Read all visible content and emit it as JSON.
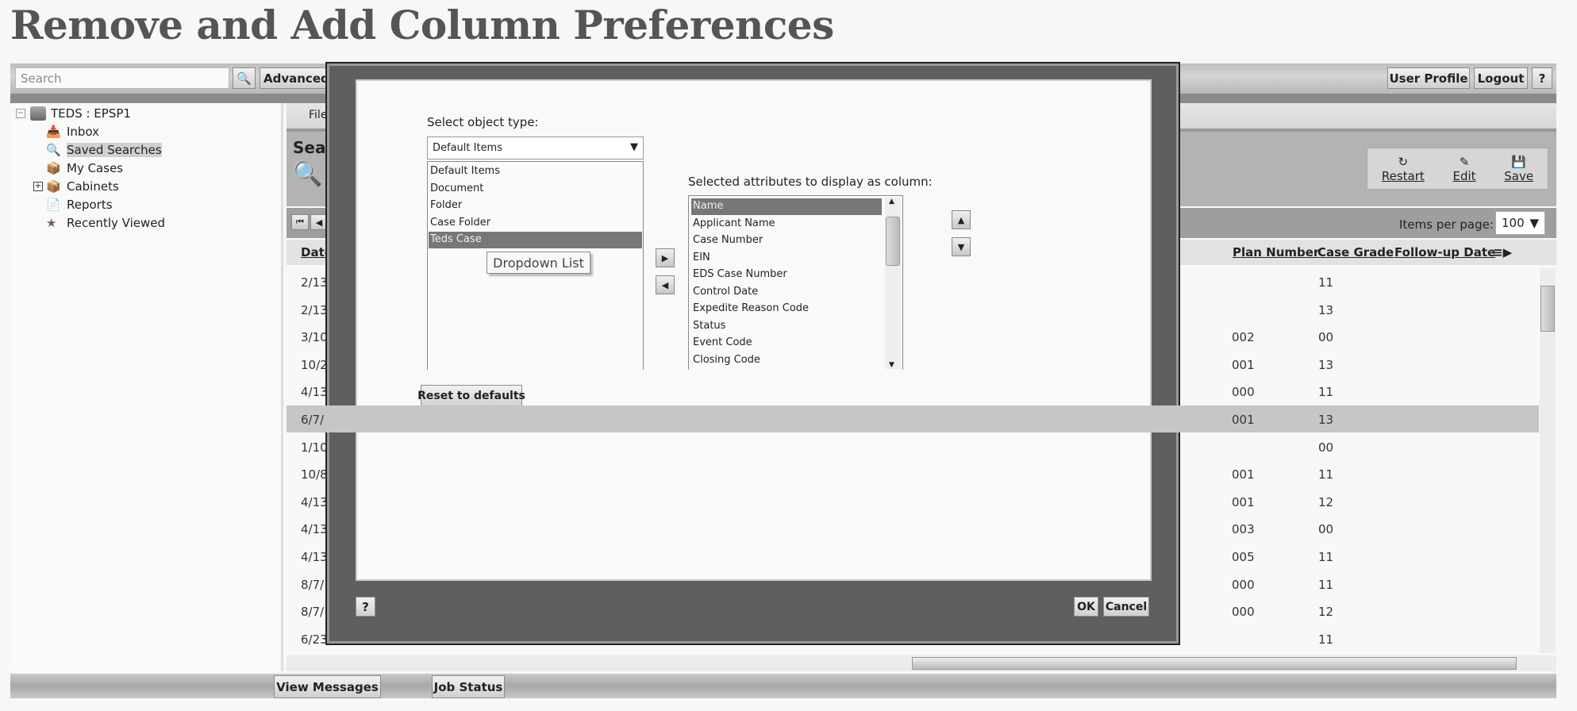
{
  "title": "Remove and Add Column Preferences",
  "topbar": {
    "search_placeholder": "Search",
    "search_icon": "magnifier",
    "advanced": "Advanced",
    "user_profile": "User Profile",
    "logout": "Logout",
    "help": "?"
  },
  "sidebar": {
    "root": "TEDS : EPSP1",
    "items": [
      {
        "label": "Inbox",
        "icon": "inbox"
      },
      {
        "label": "Saved Searches",
        "icon": "magnifier",
        "selected": true
      },
      {
        "label": "My Cases",
        "icon": "cases"
      },
      {
        "label": "Cabinets",
        "icon": "cabinets",
        "expandable": true
      },
      {
        "label": "Reports",
        "icon": "report"
      },
      {
        "label": "Recently Viewed",
        "icon": "star"
      }
    ]
  },
  "main": {
    "tab": "File",
    "panel_title": "Searc",
    "actions": [
      {
        "label": "Restart",
        "icon": "restart"
      },
      {
        "label": "Edit",
        "icon": "edit"
      },
      {
        "label": "Save",
        "icon": "floppy"
      }
    ],
    "items_per_page_label": "Items per page:",
    "items_per_page": "100",
    "columns": {
      "date": "Date",
      "plan_number": "Plan Number",
      "case_grade": "Case Grade",
      "followup_date": "Follow-up Date"
    },
    "rows": [
      {
        "date": "2/13",
        "plan": "",
        "grade": "11"
      },
      {
        "date": "2/13",
        "plan": "",
        "grade": "13"
      },
      {
        "date": "3/10",
        "plan": "002",
        "grade": "00"
      },
      {
        "date": "10/2",
        "plan": "001",
        "grade": "13"
      },
      {
        "date": "4/13",
        "plan": "000",
        "grade": "11"
      },
      {
        "date": "6/7/",
        "plan": "001",
        "grade": "13",
        "selected": true
      },
      {
        "date": "1/10",
        "plan": "",
        "grade": "00"
      },
      {
        "date": "10/8",
        "plan": "001",
        "grade": "11"
      },
      {
        "date": "4/13",
        "plan": "001",
        "grade": "12"
      },
      {
        "date": "4/13",
        "plan": "003",
        "grade": "00"
      },
      {
        "date": "4/13",
        "plan": "005",
        "grade": "11"
      },
      {
        "date": "8/7/",
        "plan": "000",
        "grade": "11"
      },
      {
        "date": "8/7/",
        "plan": "000",
        "grade": "12"
      },
      {
        "date": "6/23",
        "plan": "",
        "grade": "11"
      }
    ]
  },
  "bottom": {
    "view_messages": "View Messages",
    "job_status": "Job Status"
  },
  "dialog": {
    "object_type_label": "Select object type:",
    "object_type_value": "Default Items",
    "object_types": [
      "Default Items",
      "Document",
      "Folder",
      "Case Folder",
      "Teds Case"
    ],
    "highlighted_type": "Teds Case",
    "tooltip": "Dropdown List",
    "attributes_label": "Selected attributes to display as column:",
    "attributes": [
      "Name",
      "Applicant Name",
      "Case Number",
      "EIN",
      "EDS Case Number",
      "Control Date",
      "Expedite Reason Code",
      "Status",
      "Event Code",
      "Closing Code"
    ],
    "selected_attribute": "Name",
    "reset": "Reset to defaults",
    "help": "?",
    "ok": "OK",
    "cancel": "Cancel"
  }
}
